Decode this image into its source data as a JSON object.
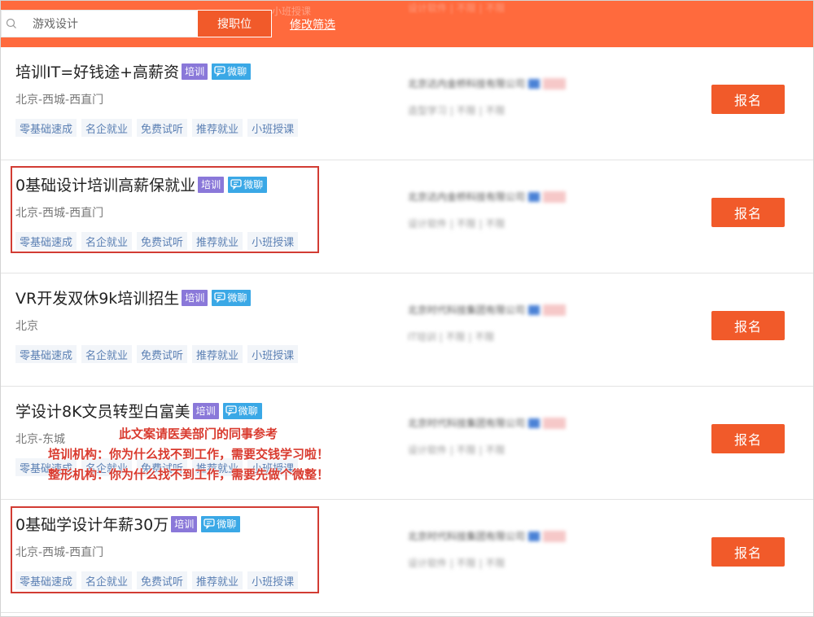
{
  "search": {
    "value": "游戏设计",
    "button_label": "搜职位",
    "filter_link": "修改筛选",
    "faded_bg_text": "小班授课",
    "faded_bg_text2": "设计软件 | 不限 | 不限"
  },
  "listings": [
    {
      "title": "培训IT=好钱途+高薪资",
      "tag_train": "培训",
      "tag_chat": "微聊",
      "location": "北京-西城-西直门",
      "benefits": [
        "零基础速成",
        "名企就业",
        "免费试听",
        "推荐就业",
        "小班授课"
      ],
      "company_name": "北京达内金桥科技有限公司",
      "company_meta": "造型学习 | 不限 | 不限",
      "apply_label": "报名"
    },
    {
      "title": "0基础设计培训高薪保就业",
      "tag_train": "培训",
      "tag_chat": "微聊",
      "location": "北京-西城-西直门",
      "benefits": [
        "零基础速成",
        "名企就业",
        "免费试听",
        "推荐就业",
        "小班授课"
      ],
      "company_name": "北京达内金桥科技有限公司",
      "company_meta": "设计软件 | 不限 | 不限",
      "apply_label": "报名"
    },
    {
      "title": "VR开发双休9k培训招生",
      "tag_train": "培训",
      "tag_chat": "微聊",
      "location": "北京",
      "benefits": [
        "零基础速成",
        "名企就业",
        "免费试听",
        "推荐就业",
        "小班授课"
      ],
      "company_name": "北京时代科技集团有限公司",
      "company_meta": "IT培训 | 不限 | 不限",
      "apply_label": "报名"
    },
    {
      "title": "学设计8K文员转型白富美",
      "tag_train": "培训",
      "tag_chat": "微聊",
      "location": "北京-东城",
      "benefits": [
        "零基础速成",
        "名企就业",
        "免费试听",
        "推荐就业",
        "小班授课"
      ],
      "company_name": "北京时代科技集团有限公司",
      "company_meta": "设计软件 | 不限 | 不限",
      "apply_label": "报名"
    },
    {
      "title": "0基础学设计年薪30万",
      "tag_train": "培训",
      "tag_chat": "微聊",
      "location": "北京-西城-西直门",
      "benefits": [
        "零基础速成",
        "名企就业",
        "免费试听",
        "推荐就业",
        "小班授课"
      ],
      "company_name": "北京时代科技集团有限公司",
      "company_meta": "设计软件 | 不限 | 不限",
      "apply_label": "报名"
    }
  ],
  "annotation": {
    "line1": "此文案请医美部门的同事参考",
    "line2": "培训机构：你为什么找不到工作，需要交钱学习啦！",
    "line3": "整形机构：你为什么找不到工作，需要先做个微整！"
  },
  "colors": {
    "topbar": "#ff6a3d",
    "accent": "#f15a2a",
    "tag_train": "#8a78d9",
    "tag_chat": "#3aa8e6",
    "highlight_border": "#d23c33",
    "annotation_text": "#d93a2e"
  }
}
